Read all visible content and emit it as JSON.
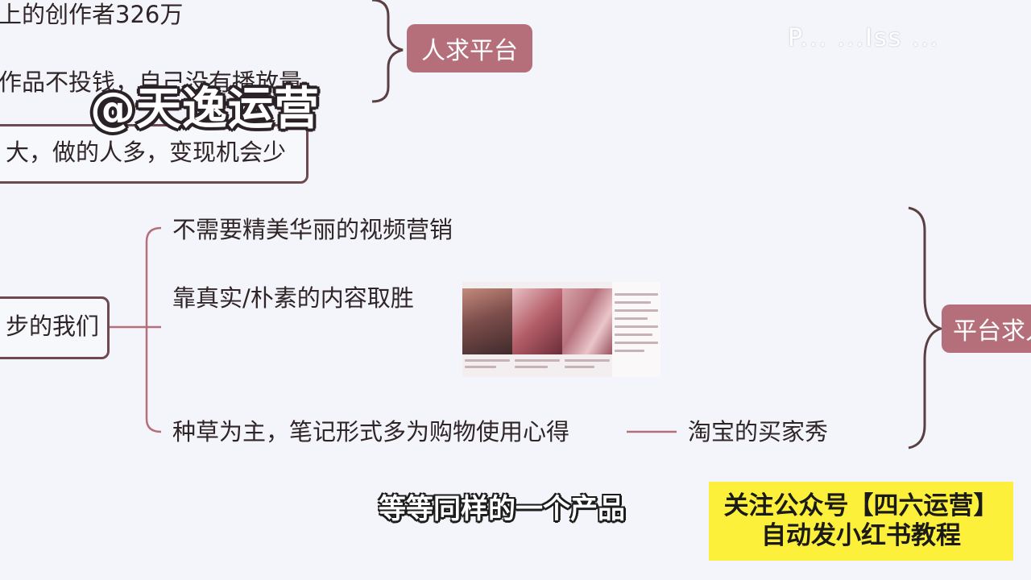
{
  "top_branch": {
    "line1": "上的创作者326万",
    "line2": "作品不投钱，自己没有播放量",
    "box_label": "大，做的人多，变现机会少",
    "pill": "人求平台"
  },
  "bottom_branch": {
    "root_label": "步的我们",
    "items": [
      "不需要精美华丽的视频营销",
      "靠真实/朴素的内容取胜",
      "种草为主，笔记形式多为购物使用心得"
    ],
    "connector_target": "淘宝的买家秀",
    "pill": "平台求人"
  },
  "overlays": {
    "watermark": "@天逸运营",
    "subtitle": "等等同样的一个产品",
    "corner_mark": "P... ...Iss ...",
    "promo_line1": "关注公众号【四六运营】",
    "promo_line2": "自动发小红书教程"
  },
  "colors": {
    "background": "#f4f5fb",
    "pill": "#b56f7a",
    "branch_line": "#b56f7a",
    "bracket": "#5a3f43",
    "promo": "#fcf03a"
  }
}
